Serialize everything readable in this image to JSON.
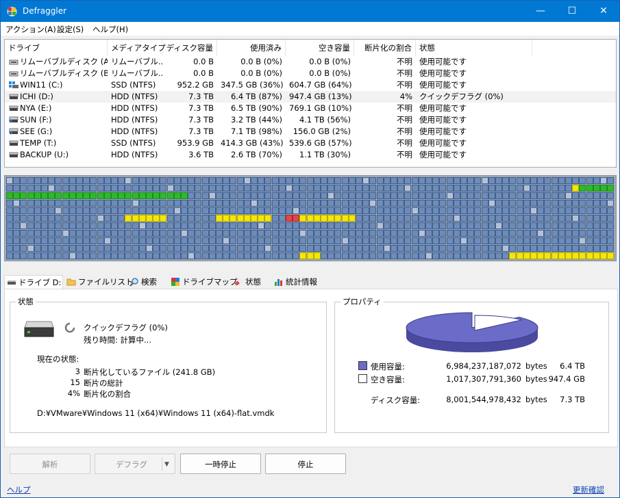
{
  "window": {
    "title": "Defraggler",
    "minimize": "—",
    "maximize": "☐",
    "close": "✕"
  },
  "menu": [
    "アクション(A)",
    "設定(S)",
    "ヘルプ(H)"
  ],
  "columns": [
    "ドライブ",
    "メディアタイプ",
    "ディスク容量",
    "使用済み",
    "空き容量",
    "断片化の割合",
    "状態"
  ],
  "drives": [
    {
      "name": "リムーバブルディスク (A:)",
      "media": "リムーバブル...",
      "size": "0.0 B",
      "used": "0.0 B (0%)",
      "free": "0.0 B (0%)",
      "frag": "不明",
      "status": "使用可能です",
      "icon": "removable-drive-icon"
    },
    {
      "name": "リムーバブルディスク (B:)",
      "media": "リムーバブル...",
      "size": "0.0 B",
      "used": "0.0 B (0%)",
      "free": "0.0 B (0%)",
      "frag": "不明",
      "status": "使用可能です",
      "icon": "removable-drive-icon"
    },
    {
      "name": "WIN11 (C:)",
      "media": "SSD (NTFS)",
      "size": "952.2 GB",
      "used": "347.5 GB (36%)",
      "free": "604.7 GB (64%)",
      "frag": "不明",
      "status": "使用可能です",
      "icon": "windows-drive-icon"
    },
    {
      "name": "ICHI (D:)",
      "media": "HDD (NTFS)",
      "size": "7.3 TB",
      "used": "6.4 TB (87%)",
      "free": "947.4 GB (13%)",
      "frag": "4%",
      "status": "クイックデフラグ (0%)",
      "icon": "hard-drive-icon"
    },
    {
      "name": "NYA (E:)",
      "media": "HDD (NTFS)",
      "size": "7.3 TB",
      "used": "6.5 TB (90%)",
      "free": "769.1 GB (10%)",
      "frag": "不明",
      "status": "使用可能です",
      "icon": "hard-drive-icon"
    },
    {
      "name": "SUN (F:)",
      "media": "HDD (NTFS)",
      "size": "7.3 TB",
      "used": "3.2 TB (44%)",
      "free": "4.1 TB (56%)",
      "frag": "不明",
      "status": "使用可能です",
      "icon": "shared-drive-icon"
    },
    {
      "name": "SEE (G:)",
      "media": "HDD (NTFS)",
      "size": "7.3 TB",
      "used": "7.1 TB (98%)",
      "free": "156.0 GB (2%)",
      "frag": "不明",
      "status": "使用可能です",
      "icon": "shared-drive-icon"
    },
    {
      "name": "TEMP (T:)",
      "media": "SSD (NTFS)",
      "size": "953.9 GB",
      "used": "414.3 GB (43%)",
      "free": "539.6 GB (57%)",
      "frag": "不明",
      "status": "使用可能です",
      "icon": "hard-drive-icon"
    },
    {
      "name": "BACKUP (U:)",
      "media": "HDD (NTFS)",
      "size": "3.6 TB",
      "used": "2.6 TB (70%)",
      "free": "1.1 TB (30%)",
      "frag": "不明",
      "status": "使用可能です",
      "icon": "hard-drive-icon"
    }
  ],
  "tabs": [
    "ドライブ D:",
    "ファイルリスト",
    "検索",
    "ドライブマップ",
    "状態",
    "統計情報"
  ],
  "status_panel": {
    "heading": "状態",
    "op": "クイックデフラグ (0%)",
    "remaining": "残り時間: 計算中...",
    "current_heading": "現在の状態:",
    "stats": [
      {
        "value": "3",
        "label": "断片化しているファイル (241.8 GB)"
      },
      {
        "value": "15",
        "label": "断片の総計"
      },
      {
        "value": "4%",
        "label": "断片化の割合"
      }
    ],
    "current_file": "D:¥VMware¥Windows 11 (x64)¥Windows 11 (x64)-flat.vmdk"
  },
  "properties": {
    "heading": "プロパティ",
    "used_label": "使用容量:",
    "used_bytes": "6,984,237,187,072",
    "used_unit": "bytes",
    "used_short": "6.4 TB",
    "free_label": "空き容量:",
    "free_bytes": "1,017,307,791,360",
    "free_unit": "bytes",
    "free_short": "947.4 GB",
    "total_label": "ディスク容量:",
    "total_bytes": "8,001,544,978,432",
    "total_unit": "bytes",
    "total_short": "7.3 TB",
    "used_color": "#6b6bc8",
    "free_color": "#ffffff",
    "used_fraction": 0.873
  },
  "buttons": {
    "analyze": "解析",
    "defrag": "デフラグ",
    "pause": "一時停止",
    "stop": "停止"
  },
  "footer": {
    "help": "ヘルプ",
    "update": "更新確認"
  },
  "colors": {
    "titlebar": "#0078d4",
    "block_used": "#6e8cba",
    "block_free": "#b4c2d8",
    "block_frag": "#e04848",
    "block_defragged": "#2fb82f",
    "block_processing": "#f5e800"
  }
}
